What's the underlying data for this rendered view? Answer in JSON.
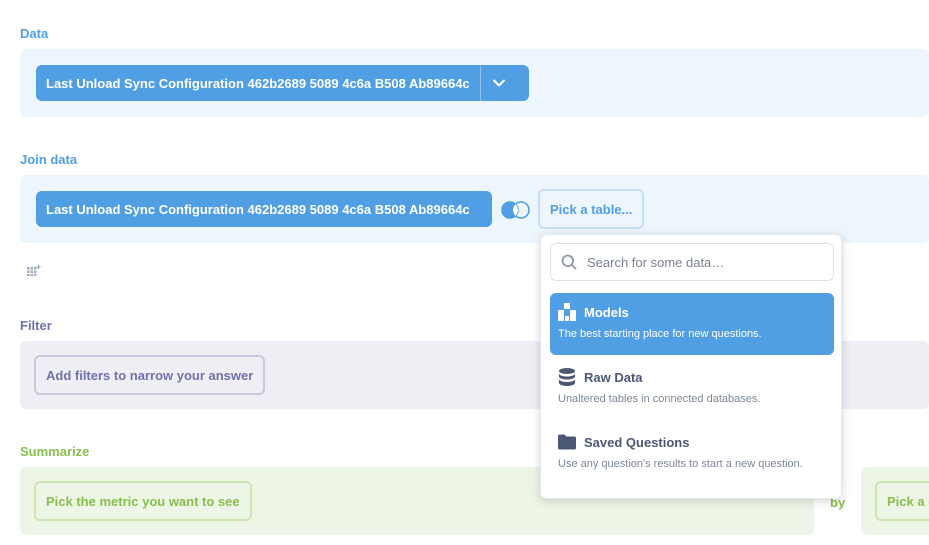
{
  "sections": {
    "data": {
      "label": "Data",
      "source_table": "Last Unload Sync Configuration 462b2689 5089 4c6a B508 Ab89664c"
    },
    "join": {
      "label": "Join data",
      "left_table": "Last Unload Sync Configuration 462b2689 5089 4c6a B508 Ab89664c",
      "pick_table_label": "Pick a table..."
    },
    "filter": {
      "label": "Filter",
      "button_label": "Add filters to narrow your answer"
    },
    "summarize": {
      "label": "Summarize",
      "metric_button_label": "Pick the metric you want to see",
      "by_label": "by",
      "group_button_label": "Pick a c"
    }
  },
  "data_picker": {
    "search_placeholder": "Search for some data…",
    "options": [
      {
        "title": "Models",
        "description": "The best starting place for new questions.",
        "icon": "model-icon",
        "active": true
      },
      {
        "title": "Raw Data",
        "description": "Unaltered tables in connected databases.",
        "icon": "database-icon",
        "active": false
      },
      {
        "title": "Saved Questions",
        "description": "Use any question's results to start a new question.",
        "icon": "folder-icon",
        "active": false
      }
    ]
  },
  "colors": {
    "brand": "#509ee3",
    "filter": "#7172ad",
    "summarize": "#88bf4d",
    "text_dark": "#4c5773"
  }
}
